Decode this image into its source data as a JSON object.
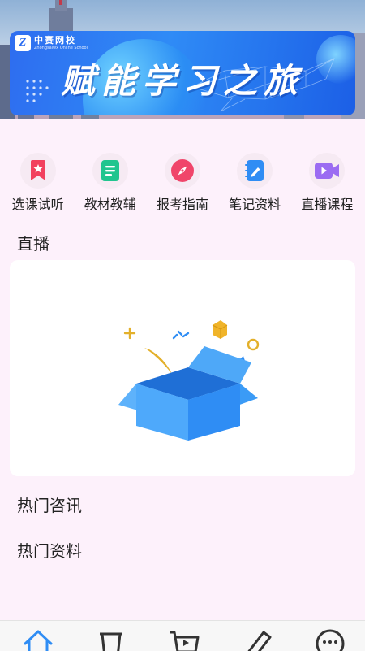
{
  "banner": {
    "logo_mark": "Z",
    "logo_name": "中赛网校",
    "logo_subtitle": "Zhongsaiwx Online School",
    "slogan": "赋能学习之旅"
  },
  "categories": [
    {
      "label": "选课试听",
      "icon": "bookmark-star-icon",
      "color": "#f2405e"
    },
    {
      "label": "教材教辅",
      "icon": "document-icon",
      "color": "#21c58f"
    },
    {
      "label": "报考指南",
      "icon": "compass-icon",
      "color": "#f0456a"
    },
    {
      "label": "笔记资料",
      "icon": "notebook-pen-icon",
      "color": "#2f8df4"
    },
    {
      "label": "直播课程",
      "icon": "video-camera-icon",
      "color": "#9b6cf2"
    }
  ],
  "sections": {
    "live": "直播",
    "news": "热门咨讯",
    "materials": "热门资料"
  },
  "live_empty_icon": "empty-box-icon",
  "tabbar": [
    {
      "icon": "home-icon",
      "active": true
    },
    {
      "icon": "basket-icon",
      "active": false
    },
    {
      "icon": "cart-icon",
      "active": false
    },
    {
      "icon": "pencil-icon",
      "active": false
    },
    {
      "icon": "chat-icon",
      "active": false
    }
  ],
  "colors": {
    "accent": "#2f8df4",
    "page_bg": "#fdf1fb",
    "box_blue": "#3b9bf6"
  }
}
